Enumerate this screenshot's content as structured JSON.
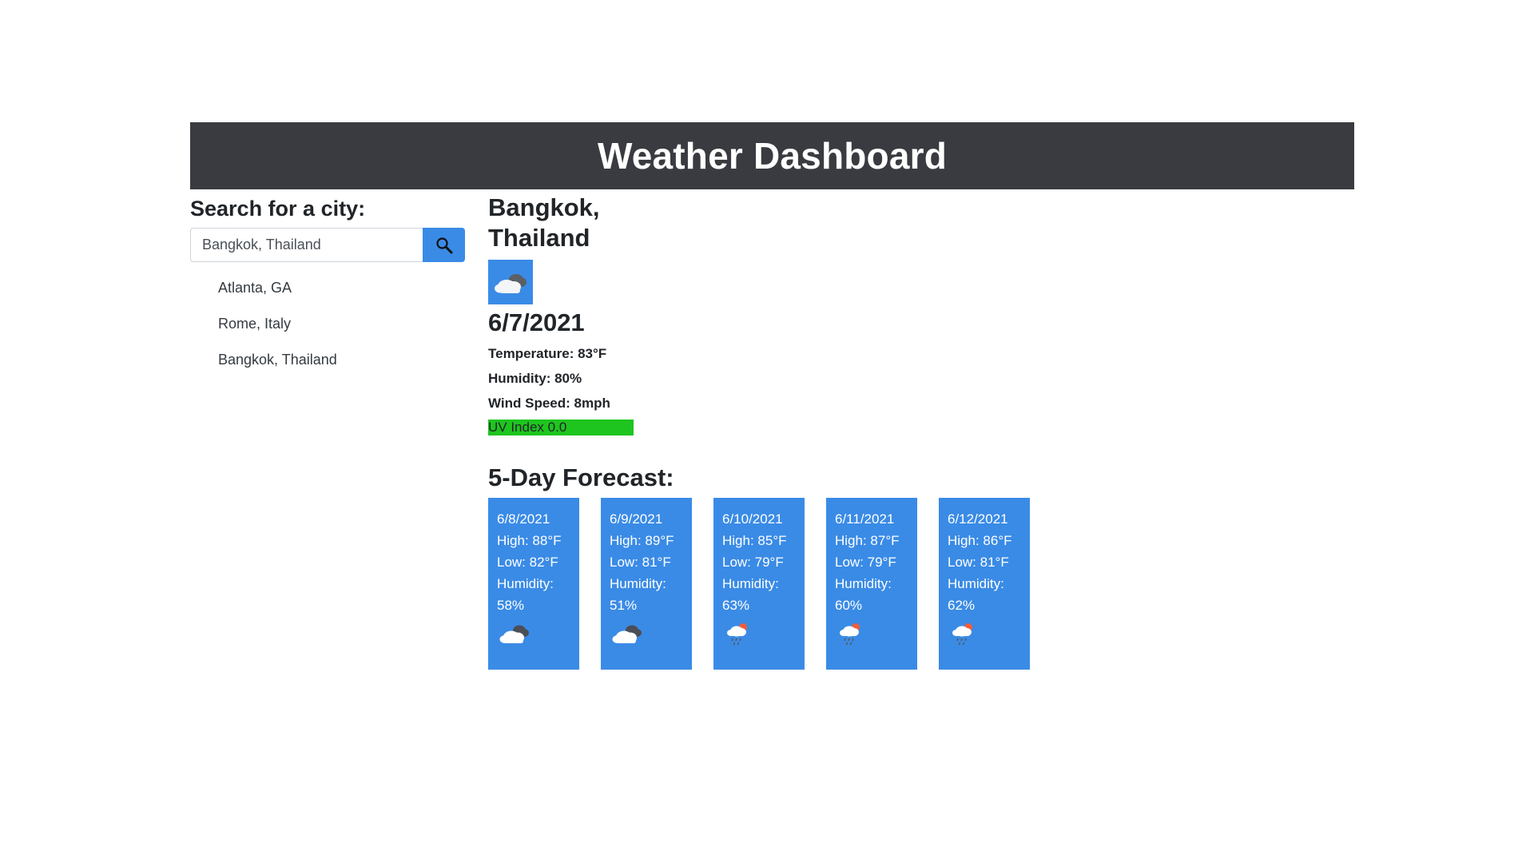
{
  "header": {
    "title": "Weather Dashboard"
  },
  "search": {
    "label": "Search for a city:",
    "input_value": "Bangkok, Thailand",
    "button_icon": "search-icon"
  },
  "history": [
    {
      "label": "Atlanta, GA"
    },
    {
      "label": "Rome, Italy"
    },
    {
      "label": "Bangkok, Thailand"
    }
  ],
  "current": {
    "city": "Bangkok, Thailand",
    "icon": "cloudy-icon",
    "date": "6/7/2021",
    "temperature": "Temperature: 83°F",
    "humidity": "Humidity: 80%",
    "wind_speed": "Wind Speed: 8mph",
    "uv_index": "UV Index 0.0",
    "uv_color": "#1ec51e"
  },
  "forecast": {
    "title": "5-Day Forecast:",
    "days": [
      {
        "date": "6/8/2021",
        "high": "High: 88°F",
        "low": "Low: 82°F",
        "humidity_label": "Humidity:",
        "humidity_value": "58%",
        "icon": "broken-clouds-icon"
      },
      {
        "date": "6/9/2021",
        "high": "High: 89°F",
        "low": "Low: 81°F",
        "humidity_label": "Humidity:",
        "humidity_value": "51%",
        "icon": "broken-clouds-icon"
      },
      {
        "date": "6/10/2021",
        "high": "High: 85°F",
        "low": "Low: 79°F",
        "humidity_label": "Humidity:",
        "humidity_value": "63%",
        "icon": "rain-icon"
      },
      {
        "date": "6/11/2021",
        "high": "High: 87°F",
        "low": "Low: 79°F",
        "humidity_label": "Humidity:",
        "humidity_value": "60%",
        "icon": "rain-icon"
      },
      {
        "date": "6/12/2021",
        "high": "High: 86°F",
        "low": "Low: 81°F",
        "humidity_label": "Humidity:",
        "humidity_value": "62%",
        "icon": "rain-icon"
      }
    ]
  },
  "colors": {
    "header_bg": "#393b40",
    "accent_blue": "#3a8be6",
    "uv_low": "#1ec51e"
  }
}
